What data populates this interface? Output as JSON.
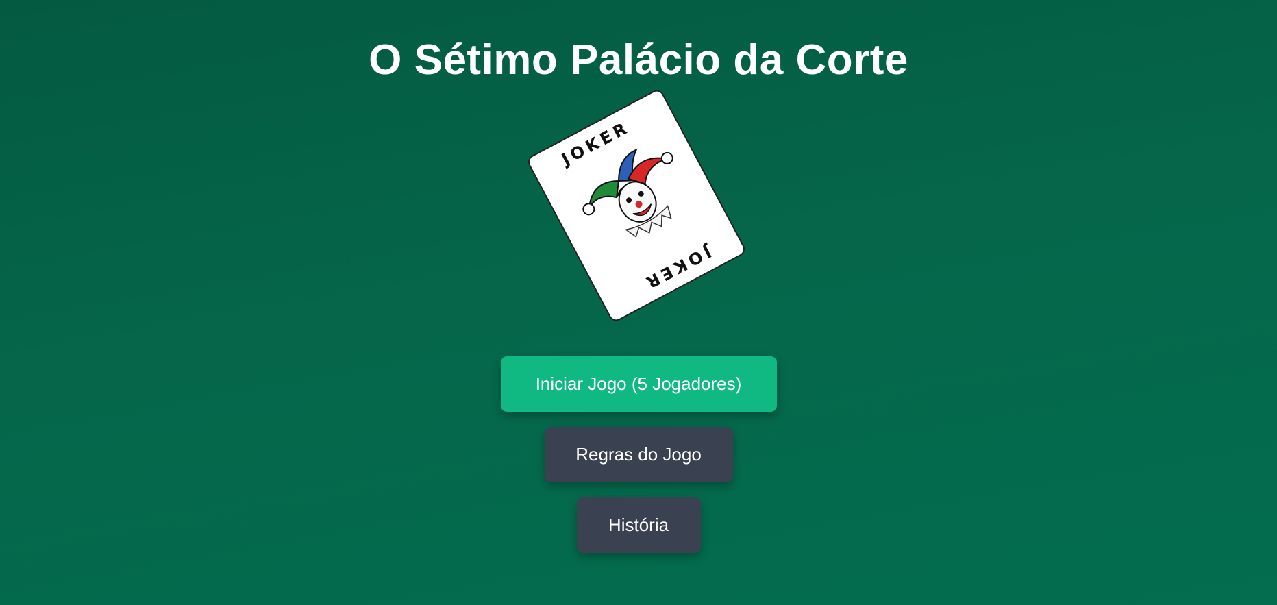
{
  "title": "O Sétimo Palácio da Corte",
  "card": {
    "label_top": "JOKER",
    "label_bottom": "JOKER",
    "icon": "jester-clown-icon"
  },
  "menu": {
    "start_label": "Iniciar Jogo (5 Jogadores)",
    "rules_label": "Regras do Jogo",
    "history_label": "História"
  },
  "colors": {
    "background": "#05664a",
    "primary_button": "#10b981",
    "secondary_button": "#3a4150"
  }
}
